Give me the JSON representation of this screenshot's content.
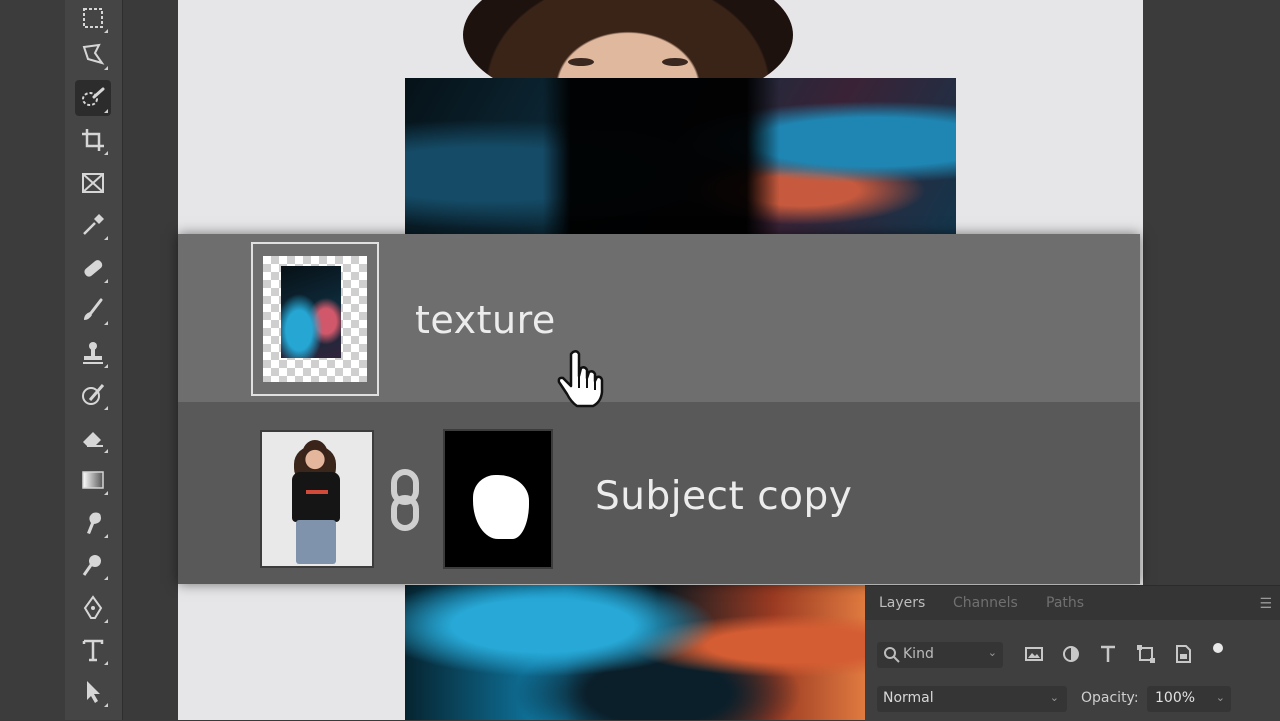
{
  "layers": [
    {
      "name": "texture",
      "selected": true
    },
    {
      "name": "Subject copy",
      "selected": false
    }
  ],
  "panel": {
    "tabs": [
      "Layers",
      "Channels",
      "Paths"
    ],
    "active_tab": "Layers",
    "filter_kind": "Kind",
    "blend_mode": "Normal",
    "opacity_label": "Opacity:",
    "opacity_value": "100%"
  },
  "toolbar": {
    "tools": [
      "marquee-tool",
      "lasso-tool",
      "quick-selection-tool",
      "crop-tool",
      "frame-tool",
      "eyedropper-tool",
      "healing-brush-tool",
      "brush-tool",
      "clone-stamp-tool",
      "history-brush-tool",
      "eraser-tool",
      "gradient-tool",
      "smudge-tool",
      "dodge-tool",
      "pen-tool",
      "type-tool",
      "path-selection-tool"
    ],
    "active_tool": "quick-selection-tool"
  },
  "colors": {
    "panel_bg": "#3f3f3f",
    "selected_row": "#6e6e6e",
    "unselected_row": "#595959",
    "toolbar_bg": "#454545"
  }
}
